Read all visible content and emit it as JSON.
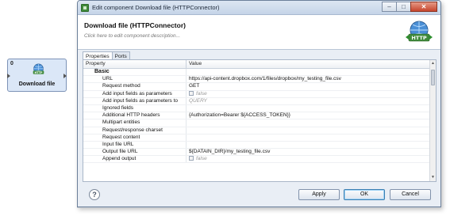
{
  "node": {
    "port_label": "0",
    "label": "Download file",
    "icon": "http-connector-icon"
  },
  "dialog": {
    "title": "Edit component Download file (HTTPConnector)",
    "header_title": "Download file (HTTPConnector)",
    "header_desc": "Click here to edit component description...",
    "header_icon": "http-connector-icon",
    "header_icon_text": "HTTP",
    "tabs": [
      "Properties",
      "Ports"
    ],
    "columns": {
      "property": "Property",
      "value": "Value"
    },
    "group": "Basic",
    "rows": [
      {
        "property": "URL",
        "value": "https://api-content.dropbox.com/1/files/dropbox/my_testing_file.csv"
      },
      {
        "property": "Request method",
        "value": "GET"
      },
      {
        "property": "Add input fields as parameters",
        "value": "false",
        "checkbox": true
      },
      {
        "property": "Add input fields as parameters to",
        "value": "QUERY"
      },
      {
        "property": "Ignored fields",
        "value": ""
      },
      {
        "property": "Additional HTTP headers",
        "value": "{Authorization=Bearer ${ACCESS_TOKEN}}"
      },
      {
        "property": "Multipart entities",
        "value": ""
      },
      {
        "property": "Request/response charset",
        "value": ""
      },
      {
        "property": "Request content",
        "value": ""
      },
      {
        "property": "Input file URL",
        "value": ""
      },
      {
        "property": "Output file URL",
        "value": "${DATAIN_DIR}/my_testing_file.csv"
      },
      {
        "property": "Append output",
        "value": "false",
        "checkbox": true
      }
    ],
    "buttons": {
      "help": "?",
      "apply": "Apply",
      "ok": "OK",
      "cancel": "Cancel"
    },
    "window_buttons": {
      "minimize": "–",
      "maximize": "□",
      "close": "✕"
    }
  },
  "colors": {
    "title_bar": "#c5d4e8",
    "close_button": "#c7452d",
    "node_bg": "#dbe7f7",
    "icon_green": "#2f8f2f"
  }
}
